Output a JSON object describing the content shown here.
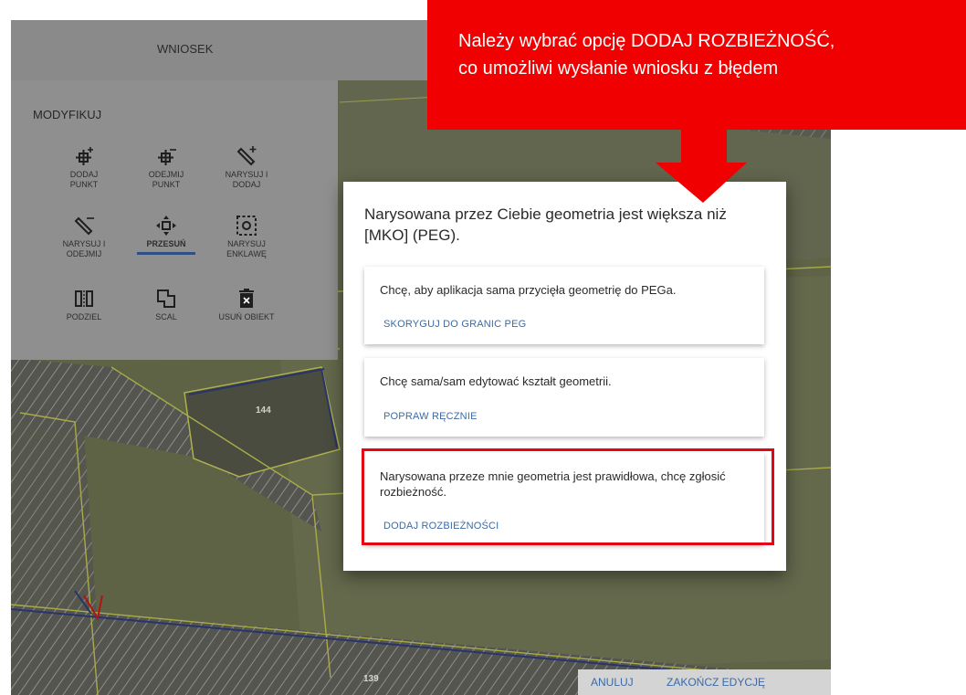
{
  "header": {
    "title": "WNIOSEK"
  },
  "panel": {
    "heading": "MODYFIKUJ",
    "tools": [
      {
        "label": "DODAJ\nPUNKT"
      },
      {
        "label": "ODEJMIJ\nPUNKT"
      },
      {
        "label": "NARYSUJ I\nDODAJ"
      },
      {
        "label": "NARYSUJ I\nODEJMIJ"
      },
      {
        "label": "PRZESUŃ"
      },
      {
        "label": "NARYSUJ\nENKLAWĘ"
      },
      {
        "label": "PODZIEL"
      },
      {
        "label": "SCAL"
      },
      {
        "label": "USUŃ OBIEKT"
      }
    ]
  },
  "map": {
    "parcel_labels": [
      "144",
      "139"
    ]
  },
  "dialog": {
    "title": "Narysowana przez Ciebie geometria jest większa niż [MKO] (PEG).",
    "options": [
      {
        "text": "Chcę, aby aplikacja sama przycięła geometrię do PEGa.",
        "button": "SKORYGUJ DO GRANIC PEG"
      },
      {
        "text": "Chcę sama/sam edytować kształt geometrii.",
        "button": "POPRAW RĘCZNIE"
      },
      {
        "text": "Narysowana przeze mnie geometria jest prawidłowa, chcę zgłosić rozbieżność.",
        "button": "DODAJ ROZBIEŻNOŚCI"
      }
    ]
  },
  "actions": {
    "cancel": "ANULUJ",
    "finish": "ZAKOŃCZ EDYCJĘ"
  },
  "callout": {
    "text": "Należy wybrać opcję DODAJ ROZBIEŻNOŚĆ,\nco umożliwi wysłanie wniosku z błędem"
  },
  "colors": {
    "accent": "#3d6aa6",
    "callout": "#f00000",
    "highlight": "#e30613"
  }
}
